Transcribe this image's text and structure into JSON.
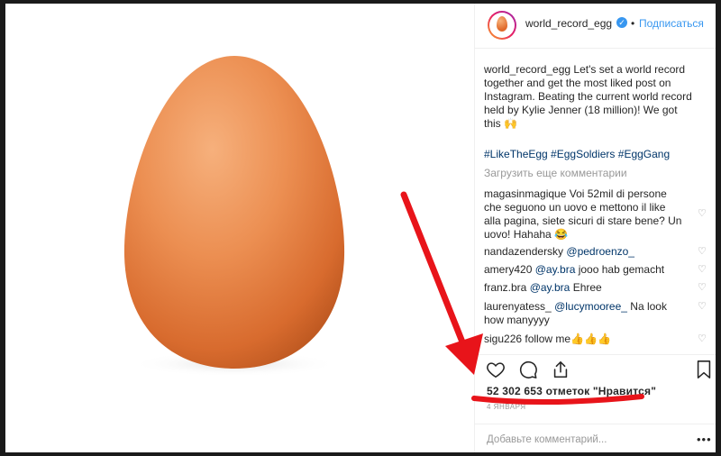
{
  "post": {
    "username": "world_record_egg",
    "verified_icon": "✓",
    "follow_label": "Подписаться",
    "caption_user": "world_record_egg",
    "caption_text": " Let's set a world record together and get the most liked post on Instagram. Beating the current world record held by Kylie Jenner (18 million)! We got this 🙌",
    "hashtags": "#LikeTheEgg #EggSoldiers #EggGang",
    "load_more": "Загрузить еще комментарии",
    "comments": [
      {
        "user": "magasinmagique",
        "text": " Voi 52mil di persone che seguono un uovo e mettono il like alla pagina, siete sicuri di stare bene? Un uovo! Hahaha 😂"
      },
      {
        "user": "nandazendersky",
        "mention": "@pedroenzo_",
        "text": ""
      },
      {
        "user": "amery420",
        "mention": "@ay.bra",
        "text": " jooo hab gemacht"
      },
      {
        "user": "franz.bra",
        "mention": "@ay.bra",
        "text": " Ehree"
      },
      {
        "user": "laurenyatess_",
        "mention": "@lucymooree_",
        "text": " Na look how manyyyy"
      },
      {
        "user": "sigu226",
        "text": " follow me👍👍👍"
      }
    ],
    "likes_text": "52 302 653 отметок \"Нравится\"",
    "date": "4 января",
    "add_comment_placeholder": "Добавьте комментарий...",
    "more_icon": "•••"
  },
  "colors": {
    "annotation": "#e8141a",
    "link": "#3897f0",
    "hashtag": "#003569",
    "egg": "#e98a4a"
  },
  "icons": [
    "heart-icon",
    "comment-icon",
    "share-icon",
    "bookmark-icon",
    "verified-badge-icon",
    "more-options-icon"
  ]
}
